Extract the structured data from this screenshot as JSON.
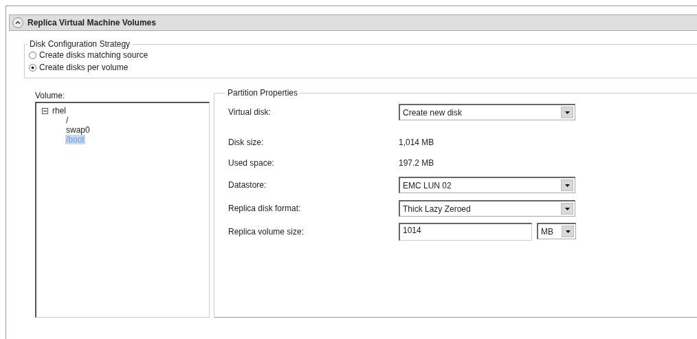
{
  "section": {
    "title": "Replica Virtual Machine Volumes",
    "expanded": true
  },
  "strategy": {
    "legend": "Disk Configuration Strategy",
    "options": [
      {
        "label": "Create disks matching source",
        "selected": false
      },
      {
        "label": "Create disks per volume",
        "selected": true
      }
    ]
  },
  "volume": {
    "label": "Volume:",
    "tree": [
      {
        "label": "rhel",
        "expanded": true,
        "selected": false,
        "children": [
          {
            "label": "/",
            "selected": false
          },
          {
            "label": "swap0",
            "selected": false
          },
          {
            "label": "/boot",
            "selected": true
          }
        ]
      }
    ]
  },
  "properties": {
    "legend": "Partition Properties",
    "rows": [
      {
        "kind": "combo",
        "label": "Virtual disk:",
        "value": "Create new disk"
      },
      {
        "kind": "text",
        "label": "Disk size:",
        "value": "1,014 MB"
      },
      {
        "kind": "text",
        "label": "Used space:",
        "value": "197.2 MB"
      },
      {
        "kind": "combo",
        "label": "Datastore:",
        "value": "EMC LUN 02"
      },
      {
        "kind": "combo",
        "label": "Replica disk format:",
        "value": "Thick Lazy Zeroed"
      },
      {
        "kind": "size",
        "label": "Replica volume size:",
        "value": "1014",
        "unit": "MB"
      }
    ]
  }
}
